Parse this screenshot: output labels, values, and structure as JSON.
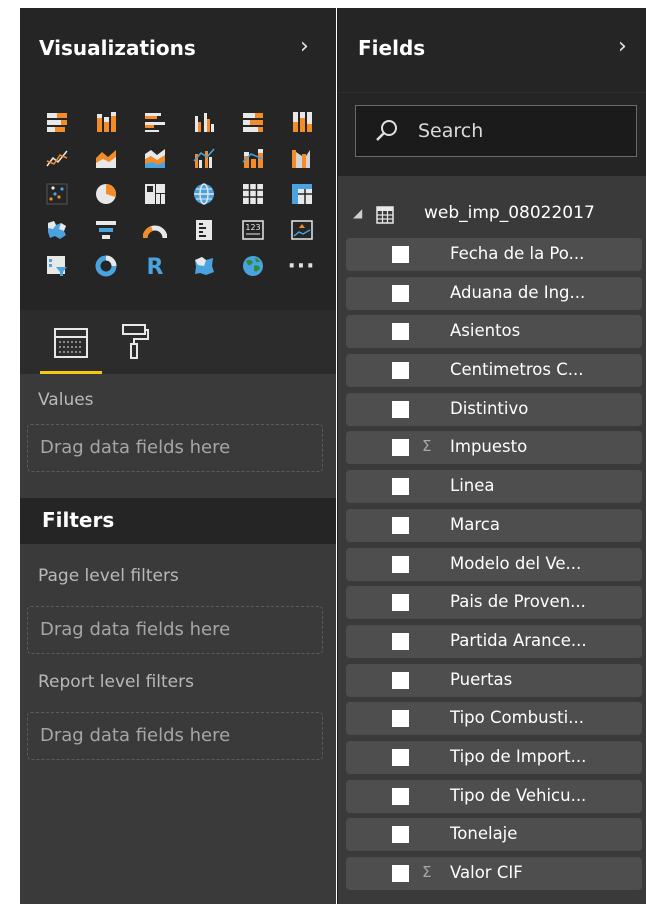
{
  "visualizations": {
    "title": "Visualizations",
    "expand_glyph": "›",
    "more_glyph": "···",
    "r_glyph": "R",
    "gallery_icons": [
      [
        "stacked-bar-chart-icon",
        "stacked-column-chart-icon",
        "clustered-bar-chart-icon",
        "clustered-column-chart-icon",
        "100-stacked-bar-chart-icon",
        "100-stacked-column-chart-icon"
      ],
      [
        "line-chart-icon",
        "area-chart-icon",
        "stacked-area-chart-icon",
        "line-clustered-column-chart-icon",
        "line-stacked-column-chart-icon",
        "ribbon-chart-icon"
      ],
      [
        "scatter-chart-icon",
        "pie-chart-icon",
        "treemap-icon",
        "map-icon",
        "table-icon",
        "matrix-icon"
      ],
      [
        "filled-map-icon",
        "funnel-icon",
        "gauge-icon",
        "multi-row-card-icon",
        "card-icon",
        "kpi-icon"
      ],
      [
        "slicer-icon",
        "donut-chart-icon",
        "r-visual-icon",
        "shape-map-icon",
        "globe-map-icon",
        "more-visuals-icon"
      ]
    ],
    "values_label": "Values",
    "drop_placeholder": "Drag data fields here",
    "filters_title": "Filters",
    "page_filters_label": "Page level filters",
    "report_filters_label": "Report level filters"
  },
  "fields": {
    "title": "Fields",
    "expand_glyph": "›",
    "search_placeholder": "Search",
    "table_expand_glyph": "◢",
    "table_name": "web_imp_08022017",
    "sigma_glyph": "Σ",
    "items": [
      {
        "label": "Fecha de la Po...",
        "sigma": false
      },
      {
        "label": "Aduana de Ing...",
        "sigma": false
      },
      {
        "label": "Asientos",
        "sigma": false
      },
      {
        "label": "Centimetros C...",
        "sigma": false
      },
      {
        "label": "Distintivo",
        "sigma": false
      },
      {
        "label": "Impuesto",
        "sigma": true
      },
      {
        "label": "Linea",
        "sigma": false
      },
      {
        "label": "Marca",
        "sigma": false
      },
      {
        "label": "Modelo del Ve...",
        "sigma": false
      },
      {
        "label": "Pais de Proven...",
        "sigma": false
      },
      {
        "label": "Partida Arance...",
        "sigma": false
      },
      {
        "label": "Puertas",
        "sigma": false
      },
      {
        "label": "Tipo Combusti...",
        "sigma": false
      },
      {
        "label": "Tipo de Import...",
        "sigma": false
      },
      {
        "label": "Tipo de Vehicu...",
        "sigma": false
      },
      {
        "label": "Tonelaje",
        "sigma": false
      },
      {
        "label": "Valor CIF",
        "sigma": true
      }
    ]
  },
  "colors": {
    "accent_yellow": "#f2c811",
    "chart_orange": "#f28c28",
    "chart_blue": "#4aa3df",
    "chart_white": "#e8e8e8",
    "checkbox": "#ffffff"
  }
}
